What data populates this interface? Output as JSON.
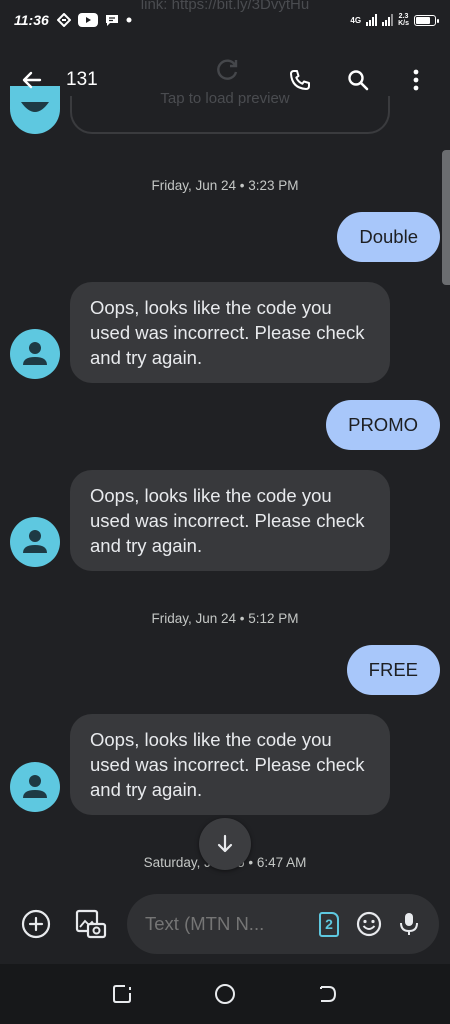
{
  "status_bar": {
    "time": "11:36",
    "network_type": "4G",
    "speed_value": "2.3",
    "speed_unit": "K/s"
  },
  "ghost": {
    "link_text": "link: https://bit.ly/3DvytHu",
    "preview_text": "Tap to load preview"
  },
  "header": {
    "title": "131"
  },
  "conversation": {
    "stamp_1": "Friday, Jun 24 • 3:23 PM",
    "sent_1": "Double",
    "received_1": "Oops, looks like the code you used was incorrect. Please check and try again.",
    "sent_2": "PROMO",
    "received_2": "Oops, looks like the code you used was incorrect. Please check and try again.",
    "stamp_2": "Friday, Jun 24 • 5:12 PM",
    "sent_3": "FREE",
    "received_3": "Oops, looks like the code you used was incorrect. Please check and try again.",
    "stamp_3": "Saturday, Jun 25 • 6:47 AM"
  },
  "compose": {
    "placeholder": "Text (MTN N...",
    "sim_number": "2"
  },
  "colors": {
    "background": "#202124",
    "sent_bubble": "#a8c7fa",
    "received_bubble": "#38393c",
    "avatar": "#5ec8e0"
  },
  "battery_level": 0.85
}
